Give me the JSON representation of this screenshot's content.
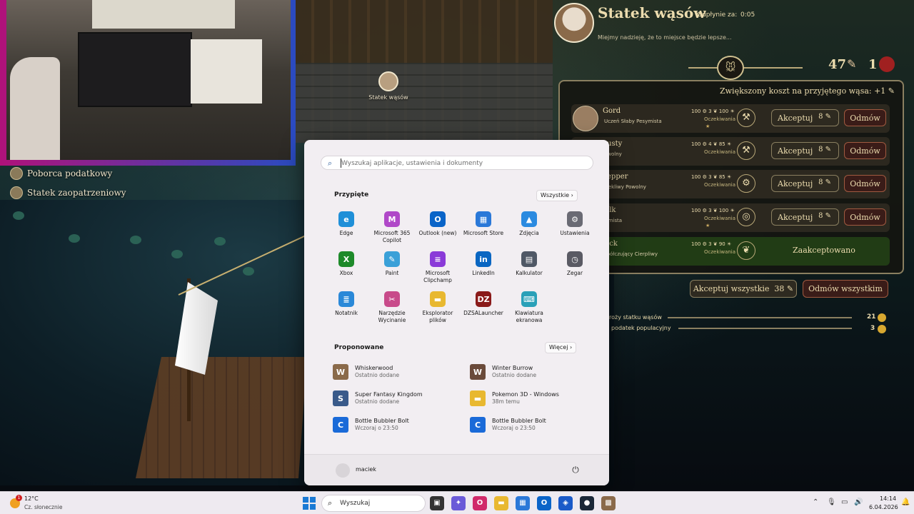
{
  "game": {
    "side_list": [
      {
        "label": "Poborca podatkowy",
        "icon": "character-portrait-icon"
      },
      {
        "label": "Statek zaopatrzeniowy",
        "icon": "character-portrait-icon"
      }
    ],
    "map_label": "Statek wąsów",
    "panel": {
      "title": "Statek wąsów",
      "expire_label": "Odpłynie za:",
      "expire_value": "0:05",
      "subtitle": "Miejmy nadzieję, że to miejsce będzie lepsze...",
      "resource_whiskers": "47",
      "resource_seal": "1",
      "cost_note": "Zwiększony koszt na przyjętego wąsa: +1",
      "applicants": [
        {
          "name": "Gord",
          "traits": "Uczeń  Słaby  Pesymista",
          "stats": "100 ⚙ 3 ❦ 100 ☀",
          "status": "Oczekiwania",
          "stars": "★",
          "trait_icon": "crossed-tools-icon",
          "accept": "Akceptuj",
          "cost": "8",
          "reject": "Odmów"
        },
        {
          "name": "usty",
          "traits": "owolny",
          "stats": "100 ⚙ 4 ❦ 85 ☀",
          "status": "Oczekiwania",
          "stars": "",
          "trait_icon": "crossed-tools-icon",
          "accept": "Akceptuj",
          "cost": "8",
          "reject": "Odmów"
        },
        {
          "name": "epper",
          "traits": "ciekliwy  Powolny",
          "stats": "100 ⚙ 3 ❦ 85 ☀",
          "status": "Oczekiwania",
          "stars": "",
          "trait_icon": "gear-icon",
          "accept": "Akceptuj",
          "cost": "8",
          "reject": "Odmów"
        },
        {
          "name": "ilk",
          "traits": "simista",
          "stats": "100 ⚙ 3 ❦ 100 ☀",
          "status": "Oczekiwania",
          "stars": "★",
          "trait_icon": "compass-icon",
          "accept": "Akceptuj",
          "cost": "8",
          "reject": "Odmów"
        },
        {
          "name": "ick",
          "traits": "spółczujący  Cierpliwy",
          "stats": "100 ⚙ 3 ❦ 90 ☀",
          "status": "Oczekiwania",
          "stars": "",
          "trait_icon": "wheat-icon",
          "accepted_text": "Zaakceptowano"
        }
      ],
      "accept_all": "Akceptuj wszystkie",
      "accept_all_cost": "38",
      "reject_all": "Odmów wszystkim",
      "bars": [
        {
          "label": "roży statku wąsów",
          "value": "21"
        },
        {
          "label": "podatek populacyjny",
          "value": "3"
        }
      ]
    }
  },
  "start_menu": {
    "search_placeholder": "Wyszukaj aplikacje, ustawienia i dokumenty",
    "pinned_title": "Przypięte",
    "pinned_button": "Wszystkie  ›",
    "pinned": [
      {
        "label": "Edge",
        "icon": "edge-icon",
        "color": "#1f8fd8",
        "glyph": "e"
      },
      {
        "label": "Microsoft 365 Copilot",
        "icon": "m365-copilot-icon",
        "color": "#b048c8",
        "glyph": "M"
      },
      {
        "label": "Outlook (new)",
        "icon": "outlook-icon",
        "color": "#0a64c8",
        "glyph": "O"
      },
      {
        "label": "Microsoft Store",
        "icon": "store-icon",
        "color": "#2a78d8",
        "glyph": "▦"
      },
      {
        "label": "Zdjęcia",
        "icon": "photos-icon",
        "color": "#2b8ae0",
        "glyph": "▲"
      },
      {
        "label": "Ustawienia",
        "icon": "gear-icon",
        "color": "#6a6a74",
        "glyph": "⚙"
      },
      {
        "label": "Xbox",
        "icon": "xbox-icon",
        "color": "#1e8a2a",
        "glyph": "X"
      },
      {
        "label": "Paint",
        "icon": "paint-icon",
        "color": "#3aa0d8",
        "glyph": "✎"
      },
      {
        "label": "Microsoft Clipchamp",
        "icon": "clipchamp-icon",
        "color": "#8a3ad8",
        "glyph": "≡"
      },
      {
        "label": "LinkedIn",
        "icon": "linkedin-icon",
        "color": "#0a66c2",
        "glyph": "in"
      },
      {
        "label": "Kalkulator",
        "icon": "calculator-icon",
        "color": "#505866",
        "glyph": "▤"
      },
      {
        "label": "Zegar",
        "icon": "clock-icon",
        "color": "#5a5a64",
        "glyph": "◷"
      },
      {
        "label": "Notatnik",
        "icon": "notepad-icon",
        "color": "#2a88d8",
        "glyph": "≣"
      },
      {
        "label": "Narzędzie Wycinanie",
        "icon": "snipping-tool-icon",
        "color": "#c84a8a",
        "glyph": "✂"
      },
      {
        "label": "Eksplorator plików",
        "icon": "file-explorer-icon",
        "color": "#e8b830",
        "glyph": "▬"
      },
      {
        "label": "DZSALauncher",
        "icon": "dzsa-launcher-icon",
        "color": "#8a1a1a",
        "glyph": "DZ"
      },
      {
        "label": "Klawiatura ekranowa",
        "icon": "keyboard-icon",
        "color": "#2aa0b8",
        "glyph": "⌨"
      }
    ],
    "recommended_title": "Proponowane",
    "recommended_button": "Więcej  ›",
    "recommended": [
      {
        "title": "Whiskerwood",
        "sub": "Ostatnio dodane",
        "icon": "whiskerwood-icon",
        "color": "#8a6a4a",
        "glyph": "W"
      },
      {
        "title": "Winter Burrow",
        "sub": "Ostatnio dodane",
        "icon": "winter-burrow-icon",
        "color": "#6a4a3a",
        "glyph": "W"
      },
      {
        "title": "Super Fantasy Kingdom",
        "sub": "Ostatnio dodane",
        "icon": "super-fantasy-kingdom-icon",
        "color": "#3a5a8a",
        "glyph": "S"
      },
      {
        "title": "Pokemon 3D - Windows",
        "sub": "38m temu",
        "icon": "folder-icon",
        "color": "#e8b830",
        "glyph": "▬"
      },
      {
        "title": "Bottle Bubbler Bolt",
        "sub": "Wczoraj o 23:50",
        "icon": "bottle-bubbler-icon",
        "color": "#1a6ad8",
        "glyph": "C"
      },
      {
        "title": "Bottle Bubbler Bolt",
        "sub": "Wczoraj o 23:50",
        "icon": "bottle-bubbler-icon",
        "color": "#1a6ad8",
        "glyph": "C"
      }
    ],
    "user_name": "maciek"
  },
  "taskbar": {
    "weather_temp": "12°C",
    "weather_desc": "Cz. słonecznie",
    "weather_badge": "1",
    "search_label": "Wyszukaj",
    "time": "14:14",
    "date": "6.04.2026",
    "apps": [
      {
        "icon": "task-view-icon",
        "color": "#333",
        "glyph": "▣"
      },
      {
        "icon": "copilot-icon",
        "color": "#6a5ad8",
        "glyph": "✦"
      },
      {
        "icon": "opera-icon",
        "color": "#d02a6a",
        "glyph": "O"
      },
      {
        "icon": "file-explorer-icon",
        "color": "#e8b830",
        "glyph": "▬"
      },
      {
        "icon": "store-icon",
        "color": "#2a78d8",
        "glyph": "▦"
      },
      {
        "icon": "outlook-icon",
        "color": "#0a64c8",
        "glyph": "O"
      },
      {
        "icon": "cube-app-icon",
        "color": "#1a5ac8",
        "glyph": "◈"
      },
      {
        "icon": "steam-icon",
        "color": "#1b2838",
        "glyph": "●"
      },
      {
        "icon": "game-app-icon",
        "color": "#8a6a4a",
        "glyph": "▩"
      }
    ]
  }
}
